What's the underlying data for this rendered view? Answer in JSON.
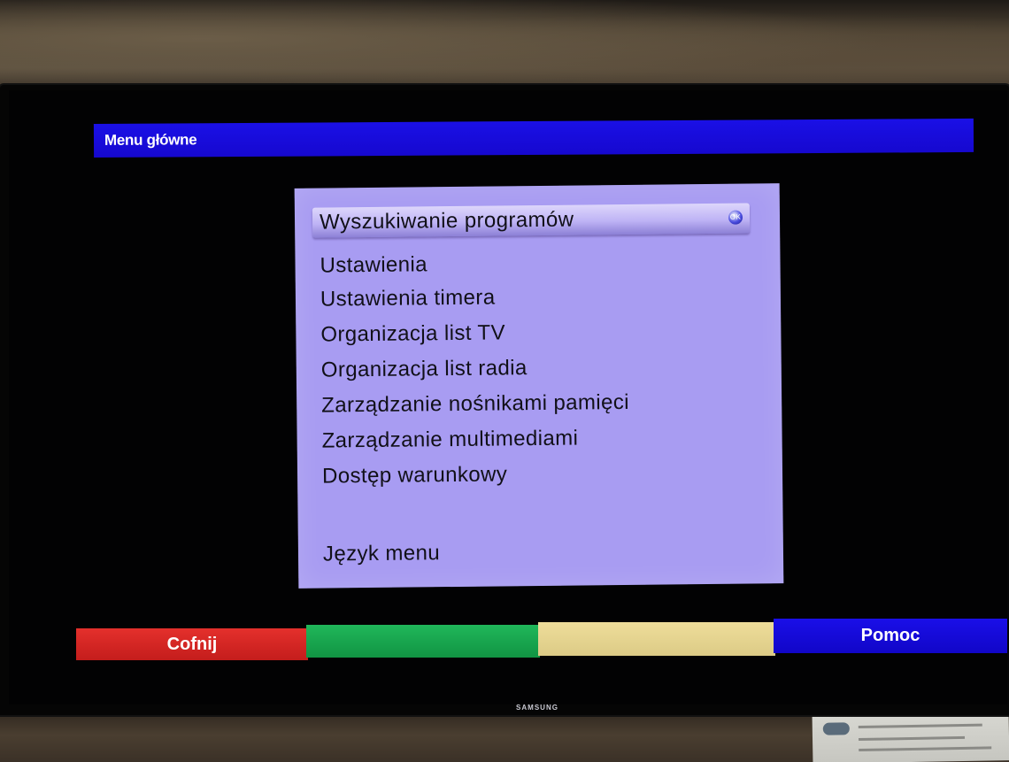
{
  "header": {
    "title": "Menu główne"
  },
  "menu": {
    "items": [
      {
        "label": "Wyszukiwanie programów",
        "selected": true
      },
      {
        "label": "Ustawienia",
        "selected": false
      },
      {
        "label": "Ustawienia timera",
        "selected": false
      },
      {
        "label": "Organizacja list TV",
        "selected": false
      },
      {
        "label": "Organizacja list radia",
        "selected": false
      },
      {
        "label": "Zarządzanie nośnikami pamięci",
        "selected": false
      },
      {
        "label": "Zarządzanie multimediami",
        "selected": false
      },
      {
        "label": "Dostęp warunkowy",
        "selected": false
      },
      {
        "label": "Język menu",
        "selected": false
      }
    ]
  },
  "buttons": {
    "red": "Cofnij",
    "green": "",
    "yellow": "",
    "blue": "Pomoc"
  },
  "tv": {
    "brand": "SAMSUNG"
  },
  "colors": {
    "title_bar": "#1a10e6",
    "menu_bg": "#a89cf2",
    "red": "#d9282a",
    "green": "#16a34c",
    "yellow": "#e6d590",
    "blue": "#1409db"
  }
}
